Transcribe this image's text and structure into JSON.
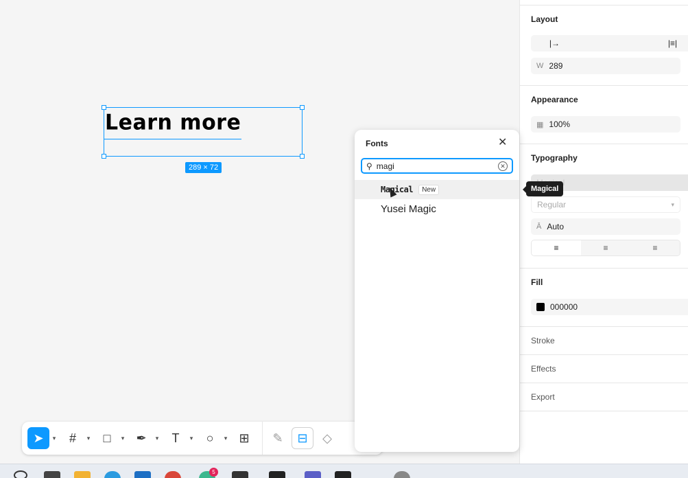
{
  "canvas": {
    "text_content": "Learn more",
    "dimensions_label": "289 × 72"
  },
  "toolbar": {
    "tools": [
      {
        "icon": "move-icon",
        "glyph": "➤",
        "active": true
      },
      {
        "icon": "frame-icon",
        "glyph": "#"
      },
      {
        "icon": "rectangle-icon",
        "glyph": "□"
      },
      {
        "icon": "pen-icon",
        "glyph": "✒"
      },
      {
        "icon": "text-icon",
        "glyph": "T"
      },
      {
        "icon": "comment-icon",
        "glyph": "○"
      },
      {
        "icon": "actions-icon",
        "glyph": "⊞"
      }
    ],
    "extra": [
      {
        "icon": "draw-icon",
        "glyph": "✎"
      },
      {
        "icon": "dev-mode-icon",
        "glyph": "⊟"
      },
      {
        "icon": "component-icon",
        "glyph": "◇"
      }
    ]
  },
  "fonts_panel": {
    "title": "Fonts",
    "search_value": "magi",
    "results": [
      {
        "name": "Magical",
        "badge": "New"
      },
      {
        "name": "Yusei Magic",
        "badge": ""
      }
    ],
    "tooltip": "Magical"
  },
  "right_panel": {
    "layout": {
      "heading": "Layout",
      "width_label": "W",
      "width_value": "289"
    },
    "appearance": {
      "heading": "Appearance",
      "opacity": "100%"
    },
    "typography": {
      "heading": "Typography",
      "font_family": "Magical",
      "font_style": "Regular",
      "line_height": "Auto"
    },
    "fill": {
      "heading": "Fill",
      "color_hex": "000000",
      "color": "#000000"
    },
    "stroke": {
      "heading": "Stroke"
    },
    "effects": {
      "heading": "Effects"
    },
    "export": {
      "heading": "Export"
    }
  },
  "taskbar": {
    "badge_count": "5"
  },
  "colors": {
    "accent": "#0d99ff"
  }
}
